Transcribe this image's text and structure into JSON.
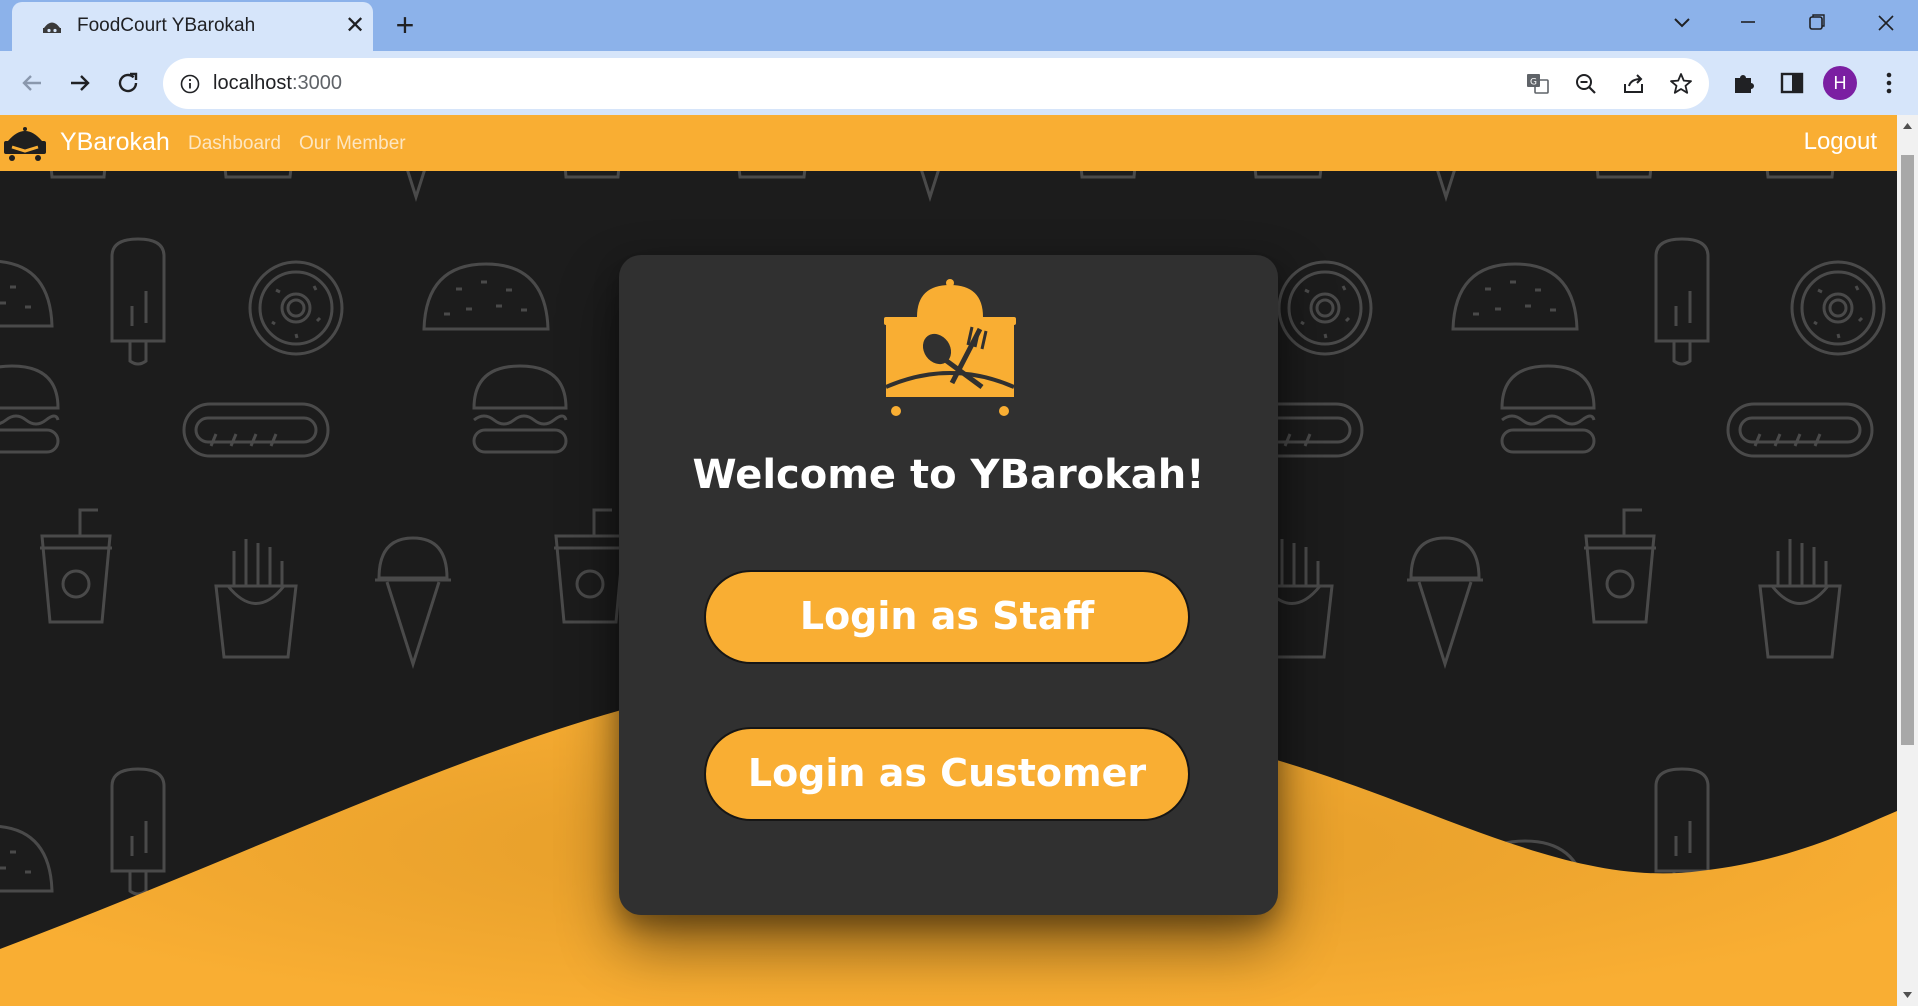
{
  "browser": {
    "tab_title": "FoodCourt YBarokah",
    "tab_close": "✕",
    "new_tab": "+",
    "url_host": "localhost",
    "url_port": ":3000",
    "avatar_initial": "H"
  },
  "app": {
    "brand": "YBarokah",
    "nav_links": [
      "Dashboard",
      "Our Member"
    ],
    "logout": "Logout",
    "accent_color": "#f9ae33"
  },
  "card": {
    "title": "Welcome to YBarokah!",
    "staff_button": "Login as Staff",
    "customer_button": "Login as Customer"
  }
}
